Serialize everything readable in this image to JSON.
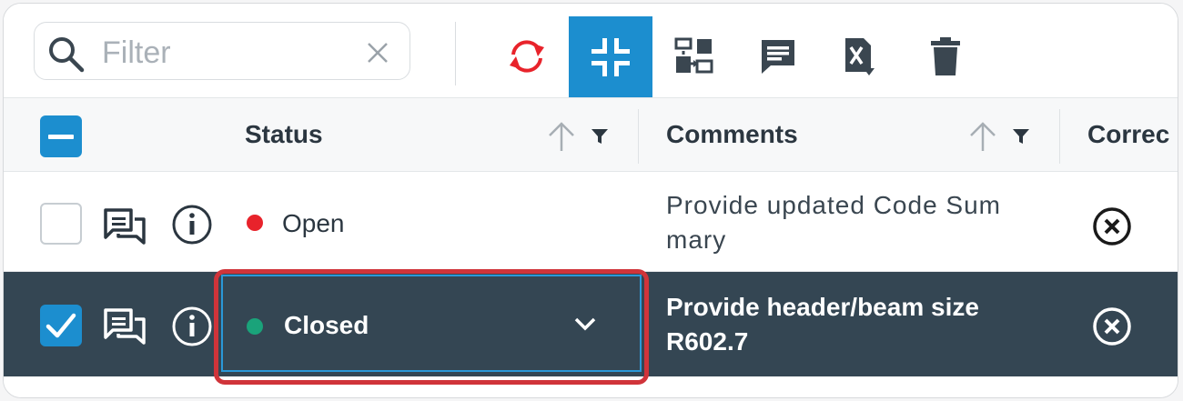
{
  "toolbar": {
    "filter_placeholder": "Filter",
    "buttons": [
      {
        "icon": "refresh-icon",
        "color": "#e8232b"
      },
      {
        "icon": "collapse-icon",
        "active": true
      },
      {
        "icon": "transfer-icon"
      },
      {
        "icon": "comment-icon"
      },
      {
        "icon": "excel-export-icon"
      },
      {
        "icon": "trash-icon"
      }
    ]
  },
  "table": {
    "columns": [
      {
        "title": "Status"
      },
      {
        "title": "Comments"
      },
      {
        "title": "Correc"
      }
    ],
    "rows": [
      {
        "selected": false,
        "status": "Open",
        "status_color": "#e8232b",
        "comment_line1": "Provide updated Code Sum",
        "comment_line2": "mary"
      },
      {
        "selected": true,
        "status": "Closed",
        "status_color": "#1aa37a",
        "comment_line1": "Provide header/beam size",
        "comment_line2": "R602.7"
      }
    ]
  },
  "colors": {
    "accent": "#1c8ecf",
    "selected_row": "#344653",
    "highlight": "#d0343a",
    "open": "#e8232b",
    "closed": "#1aa37a"
  }
}
